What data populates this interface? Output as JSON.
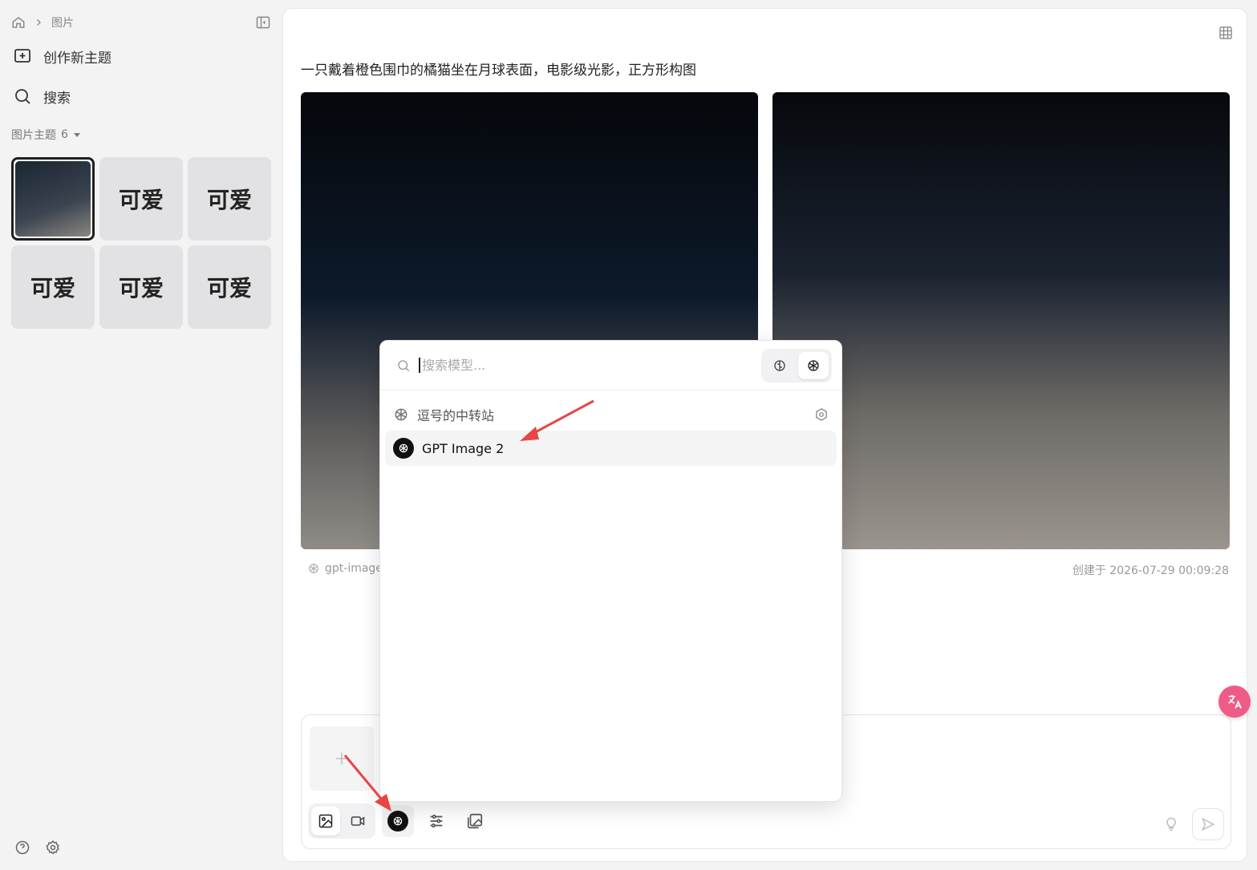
{
  "sidebar": {
    "breadcrumb": {
      "current": "图片"
    },
    "new_topic_label": "创作新主题",
    "search_label": "搜索",
    "group": {
      "title": "图片主题",
      "count": "6"
    },
    "thumbnails": [
      "",
      "可爱",
      "可爱",
      "可爱",
      "可爱",
      "可爱"
    ]
  },
  "main": {
    "prompt": "一只戴着橙色围巾的橘猫坐在月球表面，电影级光影，正方形构图",
    "model_tag": "gpt-image",
    "created_at": "创建于 2026-07-29 00:09:28"
  },
  "model_picker": {
    "search_placeholder": "搜索模型...",
    "provider_name": "逗号的中转站",
    "models": [
      {
        "name": "GPT Image 2"
      }
    ]
  },
  "colors": {
    "accent": "#1f1f1f",
    "arrow": "#e84545",
    "badge": "#ee5b87"
  }
}
